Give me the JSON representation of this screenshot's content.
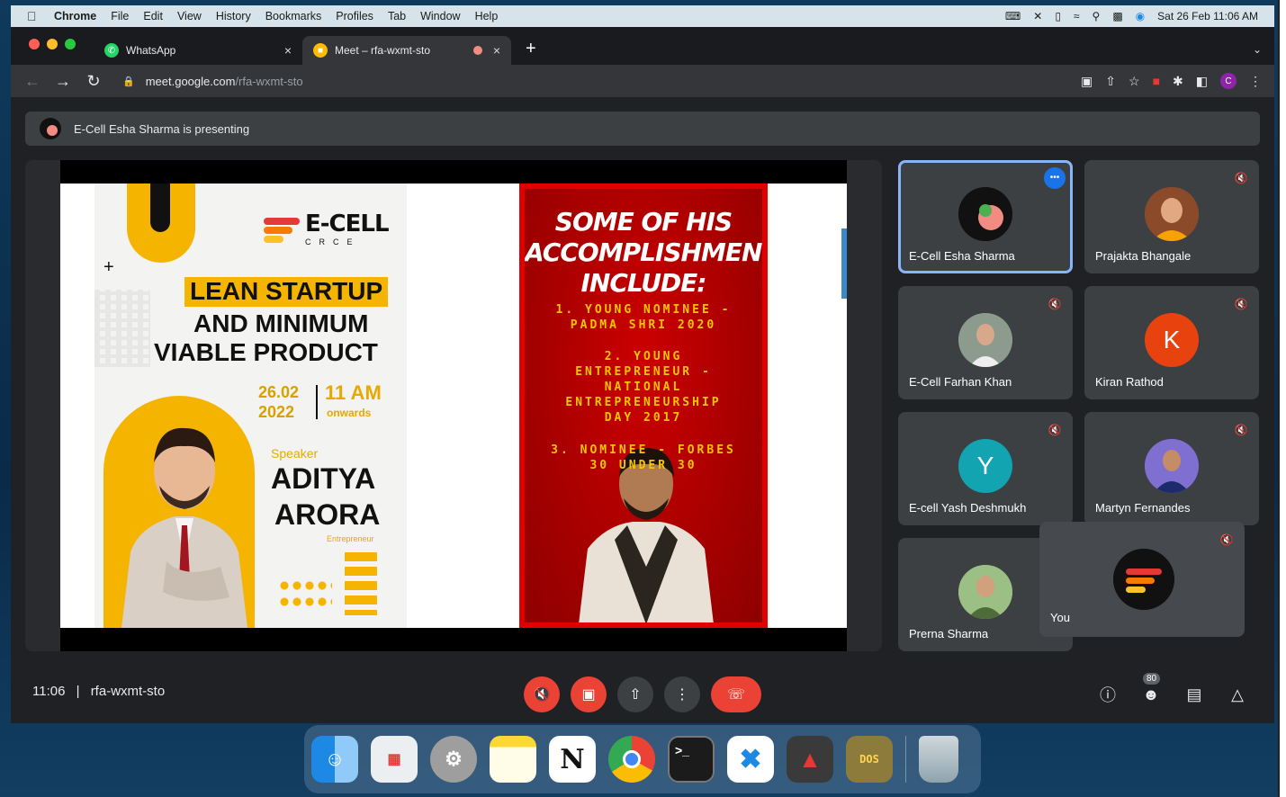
{
  "menubar": {
    "app": "Chrome",
    "menus": [
      "File",
      "Edit",
      "View",
      "History",
      "Bookmarks",
      "Profiles",
      "Tab",
      "Window",
      "Help"
    ],
    "datetime": "Sat 26 Feb  11:06 AM"
  },
  "tabs": [
    {
      "title": "WhatsApp"
    },
    {
      "title": "Meet – rfa-wxmt-sto"
    }
  ],
  "address": {
    "domain": "meet.google.com",
    "path": "/rfa-wxmt-sto"
  },
  "profile_initial": "C",
  "presenting_banner": "E-Cell Esha Sharma is presenting",
  "slide": {
    "poster1": {
      "brand": "E-CELL",
      "brand_sub": "CRCE",
      "title_highlight": "LEAN STARTUP",
      "title_line2": "AND MINIMUM",
      "title_line3": "VIABLE PRODUCT",
      "date_line1": "26.02",
      "date_line2": "2022",
      "time": "11 AM",
      "time_sub": "onwards",
      "speaker_label": "Speaker",
      "speaker_first": "ADITYA",
      "speaker_last": "ARORA",
      "speaker_role": "Entrepreneur"
    },
    "poster2": {
      "title1": "SOME OF HIS",
      "title2": "ACCOMPLISHMENTS",
      "title3": "INCLUDE:",
      "item1a": "1. YOUNG NOMINEE -",
      "item1b": "PADMA SHRI 2020",
      "item2a": "2. YOUNG",
      "item2b": "ENTREPRENEUR -",
      "item2c": "NATIONAL",
      "item2d": "ENTREPRENEURSHIP",
      "item2e": "DAY 2017",
      "item3a": "3. NOMINEE - FORBES",
      "item3b": "30 UNDER 30"
    }
  },
  "participants": [
    {
      "name": "E-Cell Esha Sharma",
      "speaking": true,
      "avatar": ""
    },
    {
      "name": "Prajakta Bhangale",
      "speaking": false,
      "avatar": ""
    },
    {
      "name": "E-Cell Farhan Khan",
      "speaking": false,
      "avatar": ""
    },
    {
      "name": "Kiran Rathod",
      "speaking": false,
      "avatar": "K",
      "color": "#e8430f"
    },
    {
      "name": "E-cell Yash Deshmukh",
      "speaking": false,
      "avatar": "Y",
      "color": "#12a4b0"
    },
    {
      "name": "Martyn Fernandes",
      "speaking": false,
      "avatar": ""
    },
    {
      "name": "Prerna Sharma",
      "speaking": false,
      "avatar": ""
    }
  ],
  "self_tile": {
    "name": "You"
  },
  "bottom": {
    "time": "11:06",
    "separator": "|",
    "meeting_code": "rfa-wxmt-sto",
    "people_count": "80"
  },
  "colors": {
    "accent": "#8ab4f8",
    "danger": "#ea4335",
    "tile": "#3c4043",
    "bg": "#202124"
  }
}
